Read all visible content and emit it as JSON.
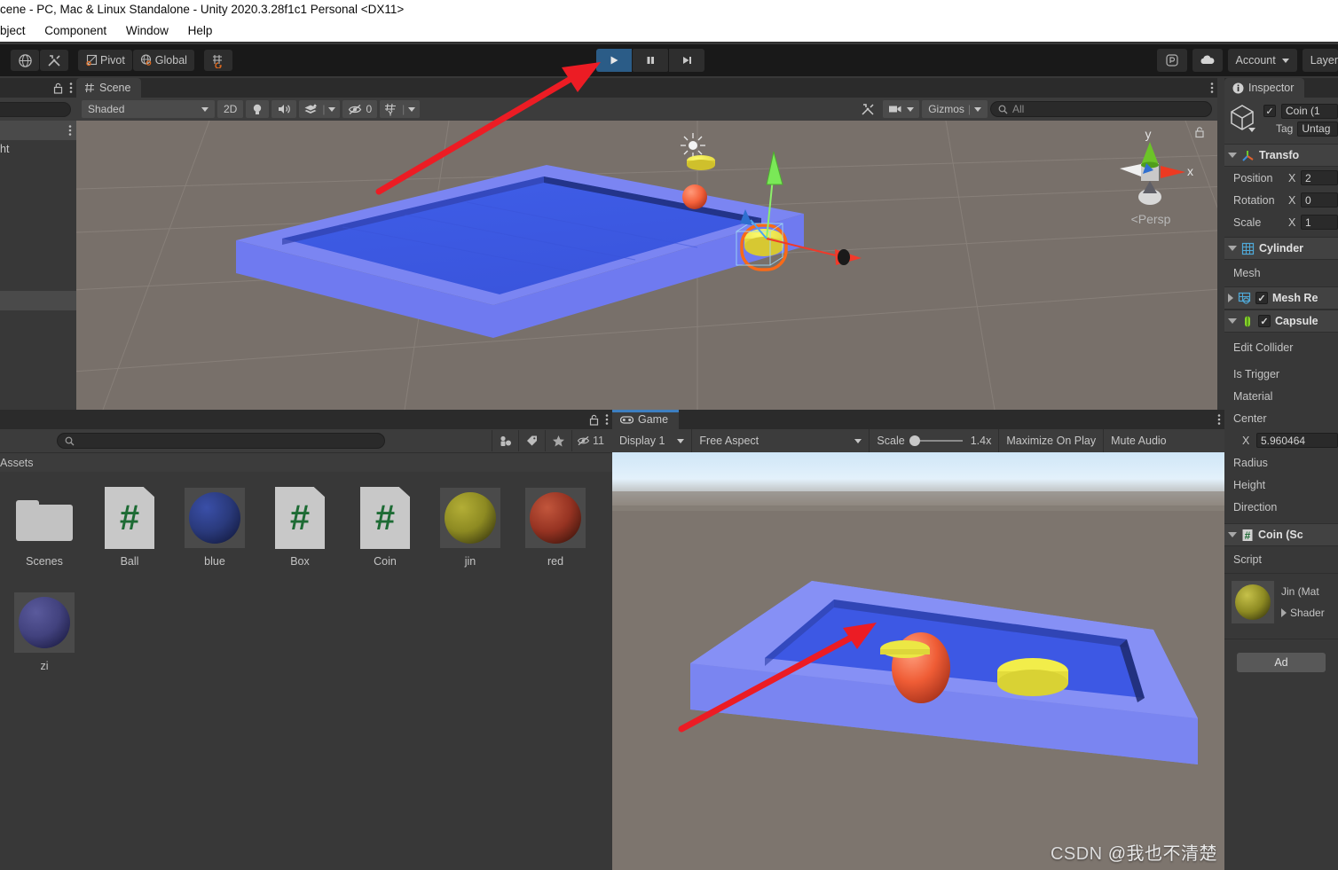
{
  "window": {
    "title": "cene - PC, Mac & Linux Standalone - Unity 2020.3.28f1c1 Personal <DX11>",
    "menu": [
      "bject",
      "Component",
      "Window",
      "Help"
    ]
  },
  "toolbar": {
    "pivot_label": "Pivot",
    "global_label": "Global",
    "play_icon": "play-icon",
    "pause_icon": "pause-icon",
    "step_icon": "step-icon",
    "collab_icon": "collab-icon",
    "cloud_icon": "cloud-icon",
    "account_label": "Account",
    "layers_label": "Layer"
  },
  "hierarchy": {
    "item_label": "ht"
  },
  "scene": {
    "tab_label": "Scene",
    "tab_icon": "grid-icon",
    "shading_mode": "Shaded",
    "mode_2d": "2D",
    "lighting_icon": "lightbulb-icon",
    "audio_icon": "speaker-icon",
    "fx_icon": "effects-icon",
    "hidden_count": "0",
    "grid_icon": "grid-visibility-icon",
    "tools_icon": "tools-icon",
    "camera_icon": "camera-icon",
    "gizmos_label": "Gizmos",
    "search_placeholder": "All",
    "gizmo": {
      "x_label": "x",
      "y_label": "y",
      "projection": "Persp"
    }
  },
  "project": {
    "search_placeholder": "",
    "breadcrumb": "Assets",
    "hidden_count": "11",
    "assets": [
      {
        "name": "Scenes",
        "kind": "folder"
      },
      {
        "name": "Ball",
        "kind": "script"
      },
      {
        "name": "blue",
        "kind": "material",
        "color": "#2a3a7c"
      },
      {
        "name": "Box",
        "kind": "script"
      },
      {
        "name": "Coin",
        "kind": "script"
      },
      {
        "name": "jin",
        "kind": "material",
        "color": "#8d8a22"
      },
      {
        "name": "red",
        "kind": "material",
        "color": "#963322"
      },
      {
        "name": "zi",
        "kind": "material",
        "color": "#42427e"
      }
    ]
  },
  "game": {
    "tab_label": "Game",
    "tab_icon": "gamepad-icon",
    "display": "Display 1",
    "aspect": "Free Aspect",
    "scale_label": "Scale",
    "scale_value": "1.4x",
    "maximize_label": "Maximize On Play",
    "mute_label": "Mute Audio"
  },
  "inspector": {
    "tab_label": "Inspector",
    "tab_icon": "info-icon",
    "object_name": "Coin (1",
    "enabled": true,
    "tag_label": "Tag",
    "tag_value": "Untag",
    "components": [
      {
        "name": "Transfo",
        "icon": "transform-icon",
        "expanded": true,
        "rows": [
          {
            "label": "Position",
            "axis": "X",
            "value": "2"
          },
          {
            "label": "Rotation",
            "axis": "X",
            "value": "0"
          },
          {
            "label": "Scale",
            "axis": "X",
            "value": "1"
          }
        ]
      },
      {
        "name": "Cylinder",
        "icon": "mesh-filter-icon",
        "expanded": true,
        "rows": [
          {
            "label": "Mesh"
          }
        ]
      },
      {
        "name": "Mesh Re",
        "icon": "mesh-renderer-icon",
        "expanded": false,
        "checked": true,
        "rows": []
      },
      {
        "name": "Capsule",
        "icon": "capsule-collider-icon",
        "expanded": true,
        "checked": true,
        "rows": [
          {
            "label": "Edit Collider"
          },
          {
            "label": "Is Trigger"
          },
          {
            "label": "Material"
          },
          {
            "label": "Center"
          },
          {
            "label": "X",
            "value": "5.960464",
            "indent": true
          },
          {
            "label": "Radius"
          },
          {
            "label": "Height"
          },
          {
            "label": "Direction"
          }
        ]
      },
      {
        "name": "Coin (Sc",
        "icon": "script-icon",
        "expanded": true,
        "rows": [
          {
            "label": "Script"
          }
        ]
      }
    ],
    "material": {
      "name": "Jin (Mat",
      "shader_label": "Shader",
      "preview_color": "#8d8a22"
    },
    "add_component_label": "Ad"
  },
  "watermark": {
    "brand": "CSDN",
    "user": "@我也不清楚"
  },
  "colors": {
    "accent_blue": "#2b5c87",
    "arrow_red": "#ec1c24",
    "panel_bg": "#383838",
    "toolbar_bg": "#191919",
    "viewport_bg": "#78706a"
  }
}
